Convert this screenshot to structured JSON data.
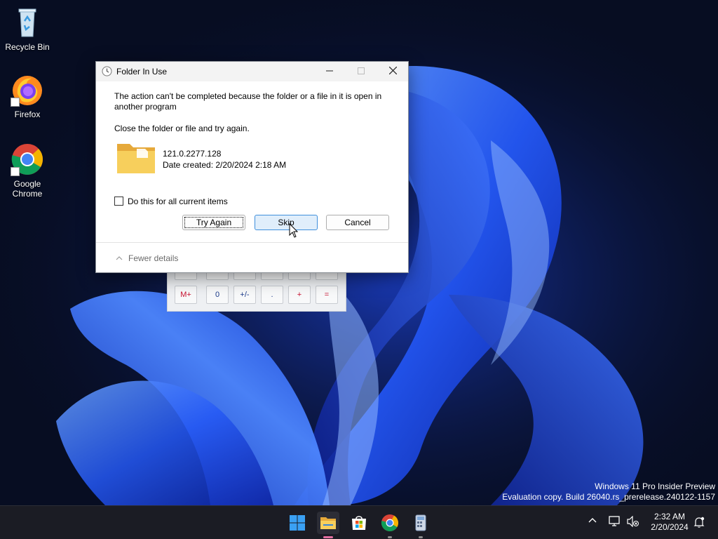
{
  "desktop": {
    "icons": [
      {
        "label": "Recycle Bin"
      },
      {
        "label": "Firefox"
      },
      {
        "label": "Google Chrome"
      }
    ],
    "watermark": {
      "line1": "Windows 11 Pro Insider Preview",
      "line2": "Evaluation copy. Build 26040.rs_prerelease.240122-1157"
    }
  },
  "calculator": {
    "keys_bottom_row": [
      "M+",
      "0",
      "+/-",
      ".",
      "+",
      "="
    ]
  },
  "dialog": {
    "title": "Folder In Use",
    "message_1": "The action can't be completed because the folder or a file in it is open in another program",
    "message_2": "Close the folder or file and try again.",
    "item_name": "121.0.2277.128",
    "item_date": "Date created: 2/20/2024 2:18 AM",
    "checkbox_label": "Do this for all current items",
    "checkbox_checked": false,
    "buttons": {
      "try_again": "Try Again",
      "skip": "Skip",
      "cancel": "Cancel"
    },
    "details_toggle": "Fewer details"
  },
  "taskbar": {
    "apps": [
      "start-icon",
      "file-explorer-icon",
      "microsoft-store-icon",
      "chrome-icon",
      "calculator-icon"
    ],
    "clock": {
      "time": "2:32 AM",
      "date": "2/20/2024"
    }
  },
  "colors": {
    "accent": "#3f8fdc",
    "taskbar": "#1b1c24",
    "wallpaper_blue": "#1f5cff"
  }
}
